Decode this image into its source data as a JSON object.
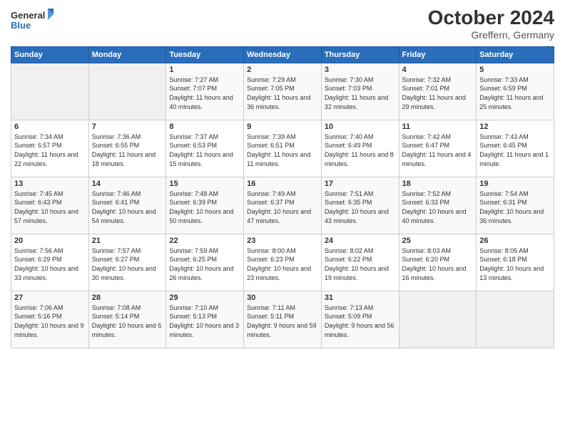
{
  "header": {
    "logo_line1": "General",
    "logo_line2": "Blue",
    "month": "October 2024",
    "location": "Greffern, Germany"
  },
  "days_of_week": [
    "Sunday",
    "Monday",
    "Tuesday",
    "Wednesday",
    "Thursday",
    "Friday",
    "Saturday"
  ],
  "weeks": [
    [
      {
        "day": "",
        "info": ""
      },
      {
        "day": "",
        "info": ""
      },
      {
        "day": "1",
        "info": "Sunrise: 7:27 AM\nSunset: 7:07 PM\nDaylight: 11 hours and 40 minutes."
      },
      {
        "day": "2",
        "info": "Sunrise: 7:29 AM\nSunset: 7:05 PM\nDaylight: 11 hours and 36 minutes."
      },
      {
        "day": "3",
        "info": "Sunrise: 7:30 AM\nSunset: 7:03 PM\nDaylight: 11 hours and 32 minutes."
      },
      {
        "day": "4",
        "info": "Sunrise: 7:32 AM\nSunset: 7:01 PM\nDaylight: 11 hours and 29 minutes."
      },
      {
        "day": "5",
        "info": "Sunrise: 7:33 AM\nSunset: 6:59 PM\nDaylight: 11 hours and 25 minutes."
      }
    ],
    [
      {
        "day": "6",
        "info": "Sunrise: 7:34 AM\nSunset: 6:57 PM\nDaylight: 11 hours and 22 minutes."
      },
      {
        "day": "7",
        "info": "Sunrise: 7:36 AM\nSunset: 6:55 PM\nDaylight: 11 hours and 18 minutes."
      },
      {
        "day": "8",
        "info": "Sunrise: 7:37 AM\nSunset: 6:53 PM\nDaylight: 11 hours and 15 minutes."
      },
      {
        "day": "9",
        "info": "Sunrise: 7:39 AM\nSunset: 6:51 PM\nDaylight: 11 hours and 11 minutes."
      },
      {
        "day": "10",
        "info": "Sunrise: 7:40 AM\nSunset: 6:49 PM\nDaylight: 11 hours and 8 minutes."
      },
      {
        "day": "11",
        "info": "Sunrise: 7:42 AM\nSunset: 6:47 PM\nDaylight: 11 hours and 4 minutes."
      },
      {
        "day": "12",
        "info": "Sunrise: 7:43 AM\nSunset: 6:45 PM\nDaylight: 11 hours and 1 minute."
      }
    ],
    [
      {
        "day": "13",
        "info": "Sunrise: 7:45 AM\nSunset: 6:43 PM\nDaylight: 10 hours and 57 minutes."
      },
      {
        "day": "14",
        "info": "Sunrise: 7:46 AM\nSunset: 6:41 PM\nDaylight: 10 hours and 54 minutes."
      },
      {
        "day": "15",
        "info": "Sunrise: 7:48 AM\nSunset: 6:39 PM\nDaylight: 10 hours and 50 minutes."
      },
      {
        "day": "16",
        "info": "Sunrise: 7:49 AM\nSunset: 6:37 PM\nDaylight: 10 hours and 47 minutes."
      },
      {
        "day": "17",
        "info": "Sunrise: 7:51 AM\nSunset: 6:35 PM\nDaylight: 10 hours and 43 minutes."
      },
      {
        "day": "18",
        "info": "Sunrise: 7:52 AM\nSunset: 6:33 PM\nDaylight: 10 hours and 40 minutes."
      },
      {
        "day": "19",
        "info": "Sunrise: 7:54 AM\nSunset: 6:31 PM\nDaylight: 10 hours and 36 minutes."
      }
    ],
    [
      {
        "day": "20",
        "info": "Sunrise: 7:56 AM\nSunset: 6:29 PM\nDaylight: 10 hours and 33 minutes."
      },
      {
        "day": "21",
        "info": "Sunrise: 7:57 AM\nSunset: 6:27 PM\nDaylight: 10 hours and 30 minutes."
      },
      {
        "day": "22",
        "info": "Sunrise: 7:59 AM\nSunset: 6:25 PM\nDaylight: 10 hours and 26 minutes."
      },
      {
        "day": "23",
        "info": "Sunrise: 8:00 AM\nSunset: 6:23 PM\nDaylight: 10 hours and 23 minutes."
      },
      {
        "day": "24",
        "info": "Sunrise: 8:02 AM\nSunset: 6:22 PM\nDaylight: 10 hours and 19 minutes."
      },
      {
        "day": "25",
        "info": "Sunrise: 8:03 AM\nSunset: 6:20 PM\nDaylight: 10 hours and 16 minutes."
      },
      {
        "day": "26",
        "info": "Sunrise: 8:05 AM\nSunset: 6:18 PM\nDaylight: 10 hours and 13 minutes."
      }
    ],
    [
      {
        "day": "27",
        "info": "Sunrise: 7:06 AM\nSunset: 5:16 PM\nDaylight: 10 hours and 9 minutes."
      },
      {
        "day": "28",
        "info": "Sunrise: 7:08 AM\nSunset: 5:14 PM\nDaylight: 10 hours and 6 minutes."
      },
      {
        "day": "29",
        "info": "Sunrise: 7:10 AM\nSunset: 5:13 PM\nDaylight: 10 hours and 3 minutes."
      },
      {
        "day": "30",
        "info": "Sunrise: 7:11 AM\nSunset: 5:11 PM\nDaylight: 9 hours and 59 minutes."
      },
      {
        "day": "31",
        "info": "Sunrise: 7:13 AM\nSunset: 5:09 PM\nDaylight: 9 hours and 56 minutes."
      },
      {
        "day": "",
        "info": ""
      },
      {
        "day": "",
        "info": ""
      }
    ]
  ]
}
